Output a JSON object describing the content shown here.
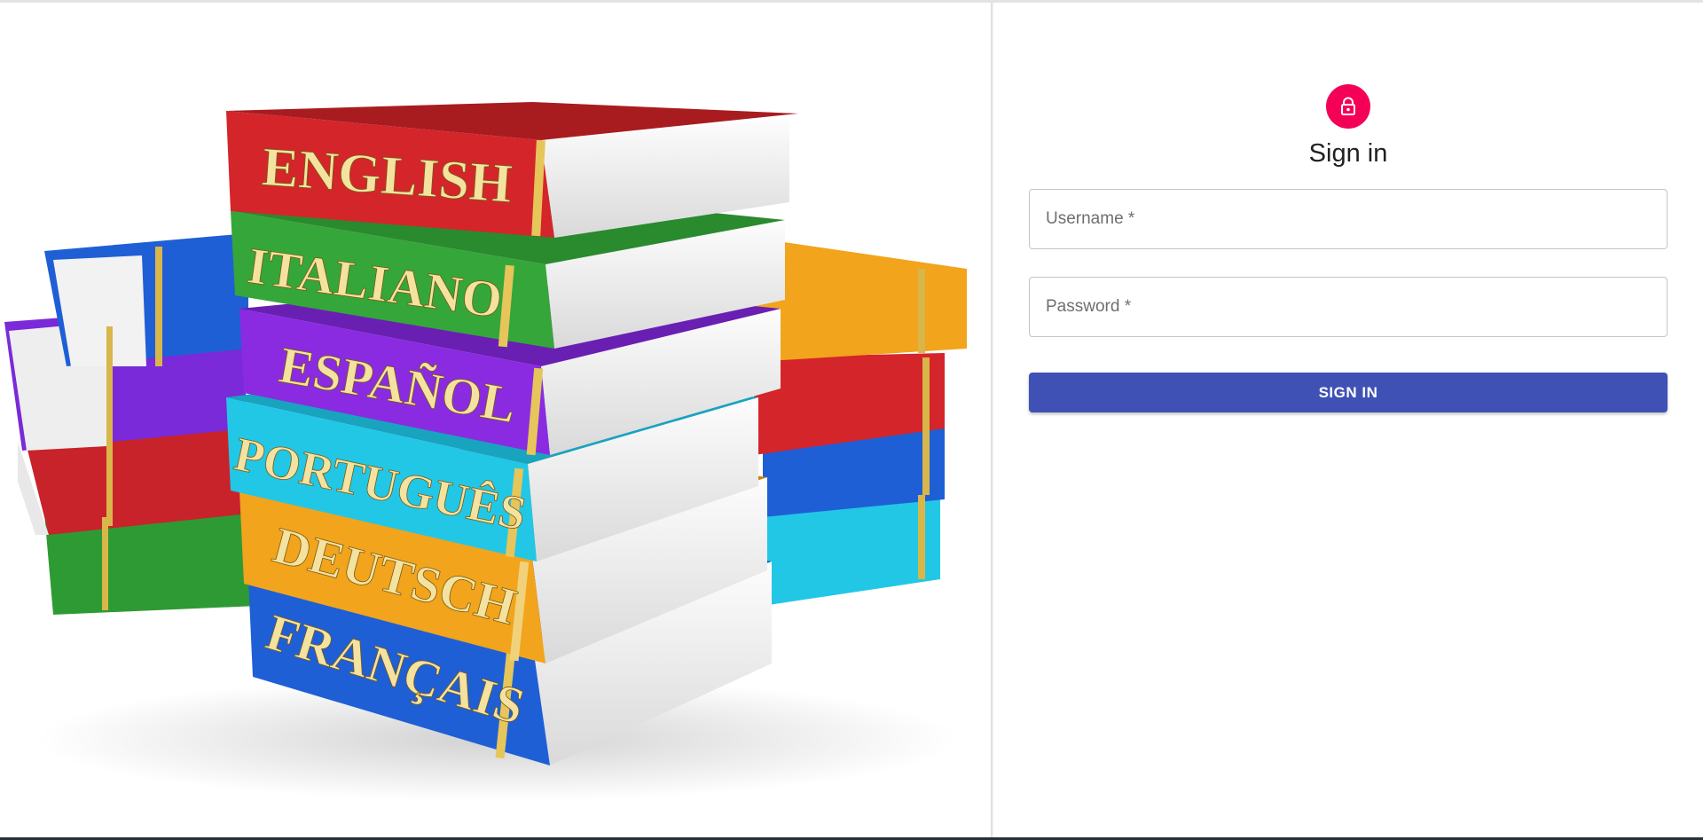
{
  "hero": {
    "books": [
      {
        "label": "ENGLISH",
        "color": "#d4252a"
      },
      {
        "label": "ITALIANO",
        "color": "#35a63a"
      },
      {
        "label": "ESPAÑOL",
        "color": "#8a2be2"
      },
      {
        "label": "PORTUGUÊS",
        "color": "#22c7e6"
      },
      {
        "label": "DEUTSCH",
        "color": "#f2a41c"
      },
      {
        "label": "FRANÇAIS",
        "color": "#1f5fd6"
      }
    ]
  },
  "signin": {
    "icon": "lock-icon",
    "title": "Sign in",
    "username_placeholder": "Username *",
    "password_placeholder": "Password *",
    "button_label": "SIGN IN",
    "accent_color": "#f50057",
    "button_color": "#3f51b5"
  }
}
